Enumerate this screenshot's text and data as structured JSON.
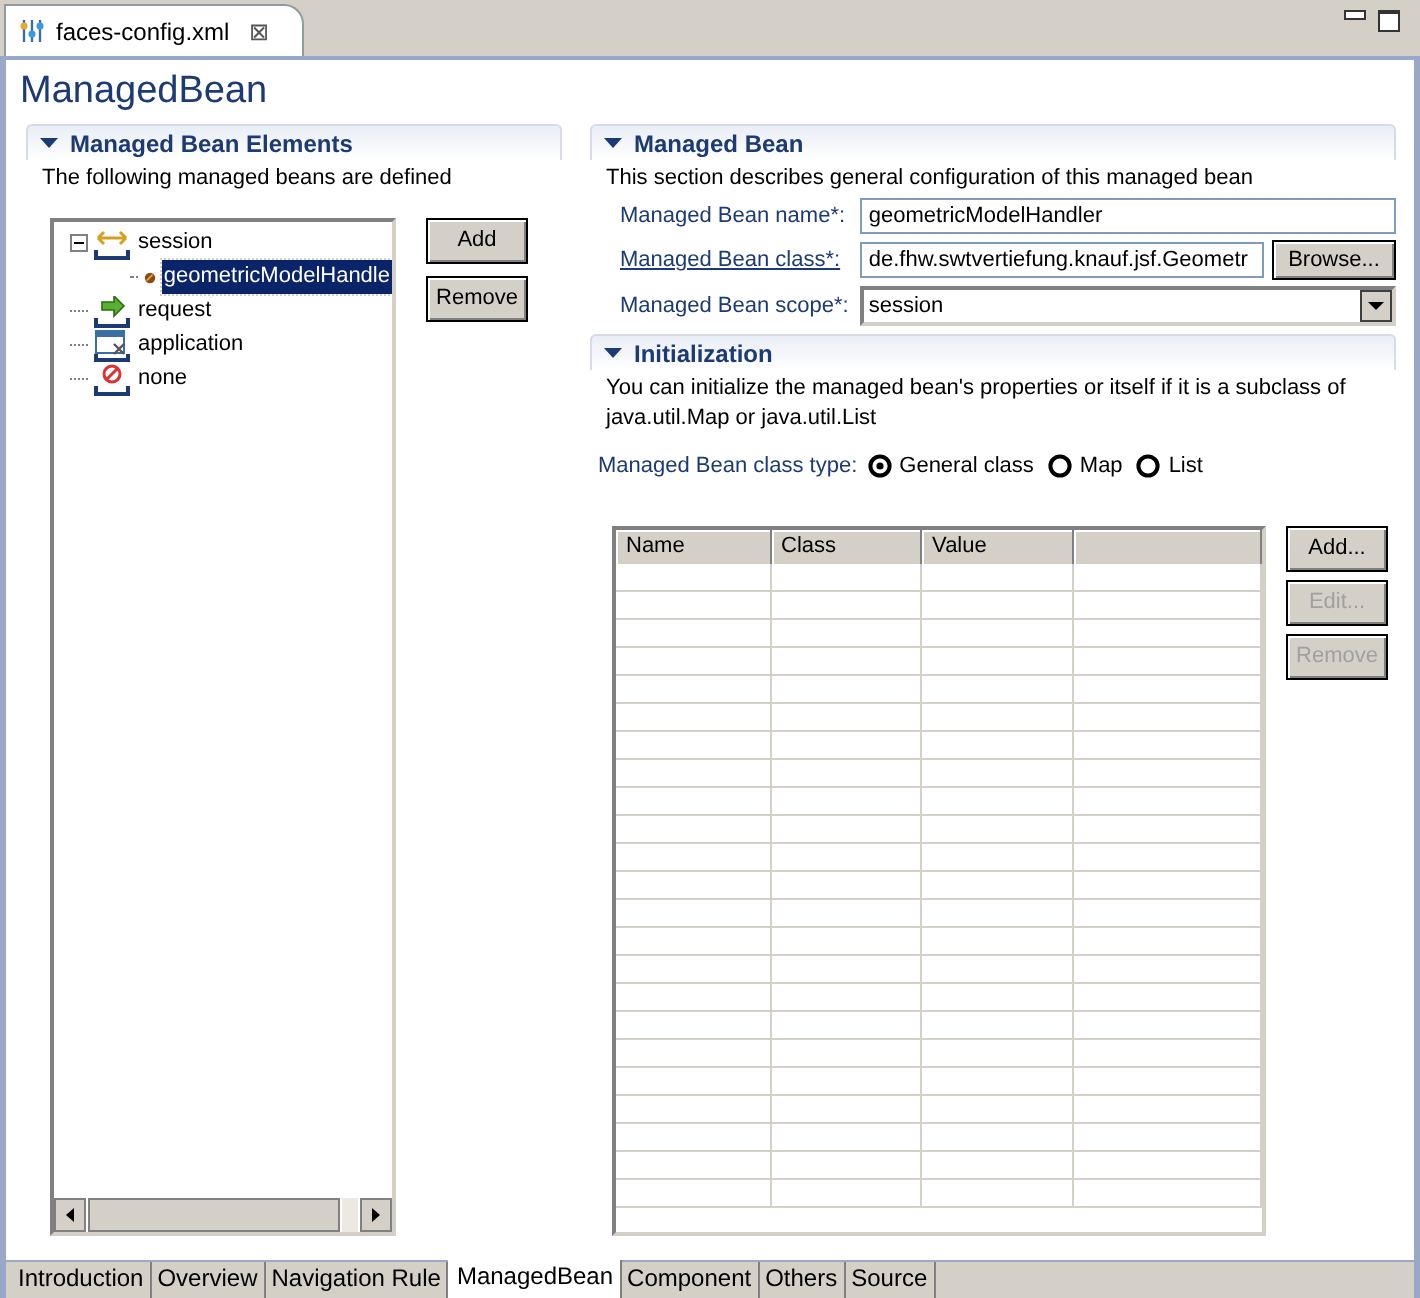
{
  "editor_tab": {
    "title": "faces-config.xml",
    "close": "⊠"
  },
  "page_title": "ManagedBean",
  "elements_section": {
    "title": "Managed Bean Elements",
    "expanded": true,
    "description": "The following managed beans are defined",
    "tree": [
      {
        "label": "session",
        "kind": "session",
        "expanded": true,
        "selected": false,
        "children": [
          {
            "label": "geometricModelHandle",
            "kind": "bean",
            "selected": true
          }
        ]
      },
      {
        "label": "request",
        "kind": "request",
        "selected": false
      },
      {
        "label": "application",
        "kind": "application",
        "selected": false
      },
      {
        "label": "none",
        "kind": "none",
        "selected": false
      }
    ],
    "buttons": [
      {
        "label": "Add",
        "disabled": false
      },
      {
        "label": "Remove",
        "disabled": false
      }
    ]
  },
  "bean_section": {
    "title": "Managed Bean",
    "expanded": true,
    "description": "This section describes general configuration of this managed bean",
    "fields": [
      {
        "kind": "text",
        "label": "Managed Bean name*:",
        "link": false,
        "value": "geometricModelHandler"
      },
      {
        "kind": "browse",
        "label": "Managed Bean class*:",
        "link": true,
        "value": "de.fhw.swtvertiefung.knauf.jsf.Geometr",
        "button": "Browse..."
      },
      {
        "kind": "combo",
        "label": "Managed Bean scope*:",
        "link": false,
        "value": "session"
      }
    ]
  },
  "init_section": {
    "title": "Initialization",
    "expanded": true,
    "description": "You can initialize the managed bean's properties or itself if it is a subclass of java.util.Map or java.util.List",
    "class_type_label": "Managed Bean class type:",
    "class_types": [
      {
        "label": "General class",
        "selected": true
      },
      {
        "label": "Map",
        "selected": false
      },
      {
        "label": "List",
        "selected": false
      }
    ],
    "table": {
      "columns": [
        "Name",
        "Class",
        "Value",
        ""
      ]
    },
    "buttons": [
      {
        "label": "Add...",
        "disabled": false
      },
      {
        "label": "Edit...",
        "disabled": true
      },
      {
        "label": "Remove",
        "disabled": true
      }
    ]
  },
  "page_tabs": [
    {
      "label": "Introduction",
      "selected": false
    },
    {
      "label": "Overview",
      "selected": false
    },
    {
      "label": "Navigation Rule",
      "selected": false
    },
    {
      "label": "ManagedBean",
      "selected": true
    },
    {
      "label": "Component",
      "selected": false
    },
    {
      "label": "Others",
      "selected": false
    },
    {
      "label": "Source",
      "selected": false
    }
  ]
}
